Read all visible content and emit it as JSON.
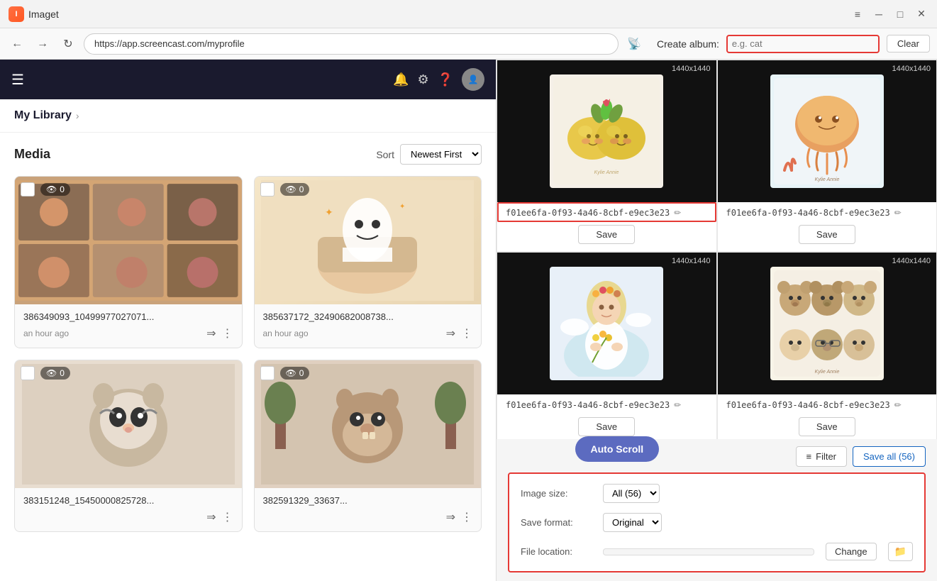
{
  "titleBar": {
    "appName": "Imaget",
    "controls": [
      "menu-icon",
      "minimize-icon",
      "maximize-icon",
      "close-icon"
    ]
  },
  "browserBar": {
    "url": "https://app.screencast.com/myprofile",
    "albumLabel": "Create album:",
    "albumPlaceholder": "e.g. cat",
    "clearButton": "Clear"
  },
  "leftPanel": {
    "libraryLink": "My Library",
    "mediaTitle": "Media",
    "sortLabel": "Sort",
    "sortOption": "Newest First",
    "mediaItems": [
      {
        "name": "386349093_10499977027071...",
        "time": "an hour ago",
        "views": "0"
      },
      {
        "name": "385637172_32490682008738...",
        "time": "an hour ago",
        "views": "0"
      },
      {
        "name": "383151248_15450000825728...",
        "time": "",
        "views": "0"
      },
      {
        "name": "382591329_33637...",
        "time": "",
        "views": "0"
      }
    ]
  },
  "rightPanel": {
    "results": [
      {
        "size": "1440x1440",
        "name": "f01ee6fa-0f93-4a46-8cbf-e9ec3e23",
        "highlighted": true,
        "theme": "lemons"
      },
      {
        "size": "1440x1440",
        "name": "f01ee6fa-0f93-4a46-8cbf-e9ec3e23",
        "highlighted": false,
        "theme": "jellyfish"
      },
      {
        "size": "1440x1440",
        "name": "f01ee6fa-0f93-4a46-8cbf-e9ec3e23",
        "highlighted": false,
        "theme": "girl"
      },
      {
        "size": "1440x1440",
        "name": "f01ee6fa-0f93-4a46-8cbf-e9ec3e23",
        "highlighted": false,
        "theme": "bears"
      }
    ],
    "saveButton": "Save",
    "filterButton": "Filter",
    "saveAllButton": "Save all (56)",
    "imageSizeLabel": "Image size:",
    "imageSizeValue": "All (56)",
    "saveFormatLabel": "Save format:",
    "saveFormatValue": "Original",
    "fileLocationLabel": "File location:",
    "fileLocationPath": "",
    "changeButton": "Change",
    "autoScrollButton": "Auto Scroll"
  }
}
